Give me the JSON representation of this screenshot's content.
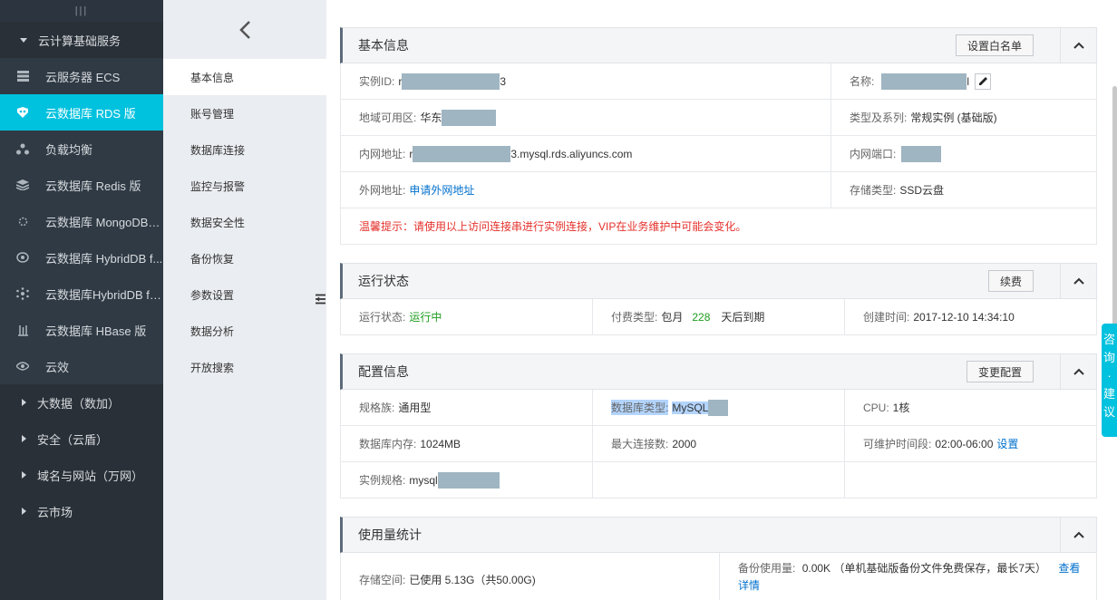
{
  "sidebar": {
    "top_glyph": "|||",
    "group_cloud": "云计算基础服务",
    "items": [
      {
        "label": "云服务器 ECS",
        "icon": "server-icon"
      },
      {
        "label": "云数据库 RDS 版",
        "icon": "database-icon",
        "active": true
      },
      {
        "label": "负载均衡",
        "icon": "load-balancer-icon"
      },
      {
        "label": "云数据库 Redis 版",
        "icon": "redis-icon"
      },
      {
        "label": "云数据库 MongoDB 版",
        "icon": "mongodb-icon"
      },
      {
        "label": "云数据库 HybridDB f...",
        "icon": "hybriddb-icon"
      },
      {
        "label": "云数据库HybridDB fo...",
        "icon": "hybriddb-network-icon"
      },
      {
        "label": "云数据库 HBase 版",
        "icon": "hbase-icon"
      },
      {
        "label": "云效",
        "icon": "eye-icon"
      }
    ],
    "groups": [
      "大数据（数加）",
      "安全（云盾）",
      "域名与网站（万网）",
      "云市场"
    ]
  },
  "subnav": {
    "items": [
      "基本信息",
      "账号管理",
      "数据库连接",
      "监控与报警",
      "数据安全性",
      "备份恢复",
      "参数设置",
      "数据分析",
      "开放搜索"
    ]
  },
  "basic": {
    "title": "基本信息",
    "whitelist_btn": "设置白名单",
    "instance_id_label": "实例ID:",
    "instance_id_prefix": "r",
    "instance_id_suffix": "3",
    "name_label": "名称:",
    "name_suffix": "l",
    "region_label": "地域可用区:",
    "region_value": "华东",
    "type_label": "类型及系列:",
    "type_value": "常规实例 (基础版)",
    "intranet_label": "内网地址:",
    "intranet_prefix": "r",
    "intranet_suffix": "3.mysql.rds.aliyuncs.com",
    "intranet_port_label": "内网端口:",
    "extranet_label": "外网地址:",
    "extranet_link": "申请外网地址",
    "storage_type_label": "存储类型:",
    "storage_type_value": "SSD云盘",
    "tip": "温馨提示：请使用以上访问连接串进行实例连接，VIP在业务维护中可能会变化。"
  },
  "status": {
    "title": "运行状态",
    "renew_btn": "续费",
    "run_label": "运行状态:",
    "run_value": "运行中",
    "pay_label": "付费类型:",
    "pay_prefix": "包月",
    "pay_days": "228",
    "pay_suffix": "天后到期",
    "created_label": "创建时间:",
    "created_value": "2017-12-10 14:34:10"
  },
  "config": {
    "title": "配置信息",
    "change_btn": "变更配置",
    "family_label": "规格族:",
    "family_value": "通用型",
    "dbtype_label": "数据库类型:",
    "dbtype_value": "MySQL",
    "cpu_label": "CPU:",
    "cpu_value": "1核",
    "mem_label": "数据库内存:",
    "mem_value": "1024MB",
    "maxconn_label": "最大连接数:",
    "maxconn_value": "2000",
    "maint_label": "可维护时间段:",
    "maint_value": "02:00-06:00",
    "maint_link": "设置",
    "spec_label": "实例规格:",
    "spec_prefix": "mysql"
  },
  "usage": {
    "title": "使用量统计",
    "storage_label": "存储空间:",
    "storage_value": "已使用 5.13G（共50.00G)",
    "backup_label": "备份使用量:",
    "backup_value": "0.00K （单机基础版备份文件免费保存，最长7天）",
    "backup_link_1": "查看",
    "backup_link_2": "详情"
  },
  "consult": [
    "咨",
    "询",
    "·",
    "建",
    "议"
  ],
  "colors": {
    "accent": "#00c1de",
    "sidebar": "#293038",
    "link": "#0070cc",
    "warn": "#e4302b",
    "running": "#1e9d1e"
  }
}
